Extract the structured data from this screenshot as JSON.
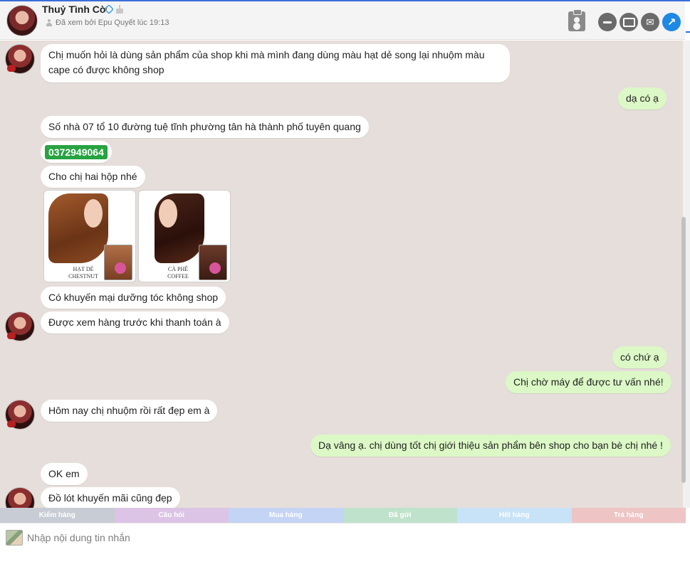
{
  "header": {
    "name": "Thuỷ Tình Cờ",
    "seen_status": "Đã xem bởi Epu Quyết lúc 19:13"
  },
  "messages": [
    {
      "id": "m1",
      "dir": "in",
      "text": "Chị muốn hỏi là dùng sản phẩm của shop khi mà mình đang dùng màu hạt dẻ song lại nhuộm màu cape có được không shop"
    },
    {
      "id": "m2",
      "dir": "out",
      "text": "dạ có ạ"
    },
    {
      "id": "m3",
      "dir": "in",
      "text": "Số nhà 07 tổ 10 đường tuệ tĩnh phường tân hà thành phố tuyên quang"
    },
    {
      "id": "m4",
      "dir": "in",
      "text": "0372949064"
    },
    {
      "id": "m5",
      "dir": "in",
      "text": "Cho chị hai hộp nhé"
    },
    {
      "id": "m6",
      "dir": "in",
      "text": "Có khuyến mại dưỡng tóc không shop"
    },
    {
      "id": "m7",
      "dir": "in",
      "text": "Được xem hàng trước khi thanh toán à"
    },
    {
      "id": "m8",
      "dir": "out",
      "text": "có chứ ạ"
    },
    {
      "id": "m9",
      "dir": "out",
      "text": "Chị chờ máy để được tư vấn nhé!"
    },
    {
      "id": "m10",
      "dir": "in",
      "text": "Hôm nay chị nhuộm rồi rất đẹp em à"
    },
    {
      "id": "m11",
      "dir": "out",
      "text": "Dạ vâng ạ. chị dùng tốt chị giới thiệu sản phẩm bên shop cho bạn bè chị nhé !"
    },
    {
      "id": "m12",
      "dir": "in",
      "text": "OK em"
    },
    {
      "id": "m13",
      "dir": "in",
      "text": "Đồ lót khuyến mãi cũng đẹp"
    }
  ],
  "photos": [
    {
      "caption_line1": "HẠT DẺ",
      "caption_line2": "CHESTNUT"
    },
    {
      "caption_line1": "CÀ PHÊ",
      "caption_line2": "COFFEE"
    }
  ],
  "quick_tags": [
    {
      "label": "Kiểm hàng",
      "color": "#c8ccd4"
    },
    {
      "label": "Câu hỏi",
      "color": "#dcc4e6"
    },
    {
      "label": "Mua hàng",
      "color": "#c4d4f4"
    },
    {
      "label": "Đã gửi",
      "color": "#bfe2cc"
    },
    {
      "label": "Hết hàng",
      "color": "#c8e2f8"
    },
    {
      "label": "Trả hàng",
      "color": "#eec4c4"
    }
  ],
  "composer": {
    "placeholder": "Nhập nội dung tin nhắn"
  },
  "icons": {
    "header_actions": [
      "clipboard-icon",
      "minimize-icon",
      "inbox-icon",
      "mail-icon",
      "open-external-icon"
    ]
  }
}
